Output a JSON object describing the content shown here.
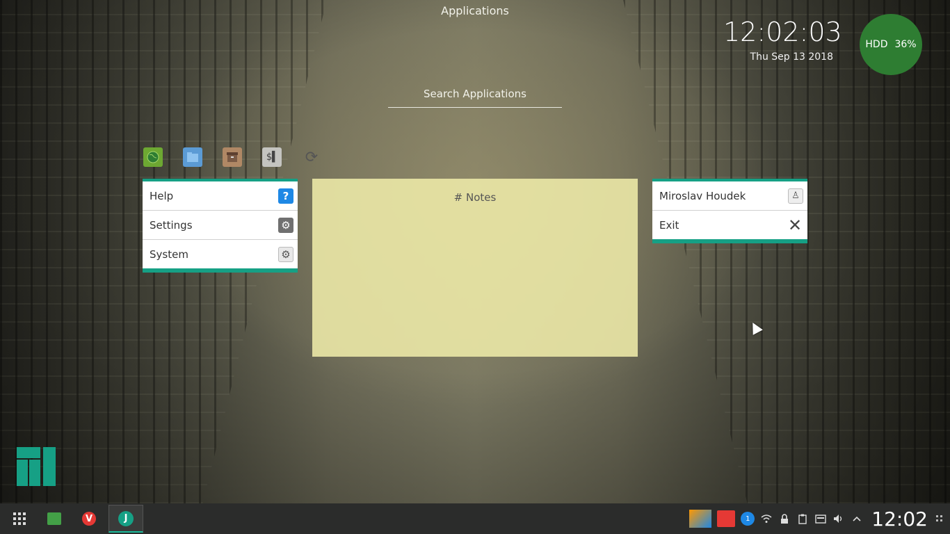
{
  "header": {
    "title": "Applications"
  },
  "search": {
    "placeholder": "Search Applications"
  },
  "clock": {
    "time": "12:02:03",
    "date": "Thu Sep 13 2018"
  },
  "hdd": {
    "label": "HDD",
    "value": "36%"
  },
  "favorites": [
    {
      "icon": "globe-icon"
    },
    {
      "icon": "folder-icon"
    },
    {
      "icon": "archive-icon"
    },
    {
      "icon": "terminal-icon"
    },
    {
      "icon": "refresh-icon"
    }
  ],
  "left_panel": {
    "items": [
      {
        "label": "Help",
        "icon": "help-icon"
      },
      {
        "label": "Settings",
        "icon": "gear-icon"
      },
      {
        "label": "System",
        "icon": "gear-icon"
      }
    ]
  },
  "notes": {
    "title": "# Notes"
  },
  "right_panel": {
    "items": [
      {
        "label": "Miroslav Houdek",
        "icon": "user-icon"
      },
      {
        "label": "Exit",
        "icon": "close-icon"
      }
    ]
  },
  "taskbar": {
    "apps": [
      {
        "name": "launcher",
        "icon": "grid-icon"
      },
      {
        "name": "files",
        "icon": "folder-icon"
      },
      {
        "name": "vivaldi",
        "icon": "vivaldi-icon",
        "glyph": "V"
      },
      {
        "name": "journal",
        "icon": "j-app-icon",
        "glyph": "J"
      }
    ],
    "tray": {
      "update_badge": "1",
      "time": "12:02"
    }
  },
  "colors": {
    "accent": "#16a085",
    "notes_bg": "#eeeaa8",
    "hdd_bg": "#2e7d32",
    "taskbar_bg": "#2b2c2b"
  }
}
